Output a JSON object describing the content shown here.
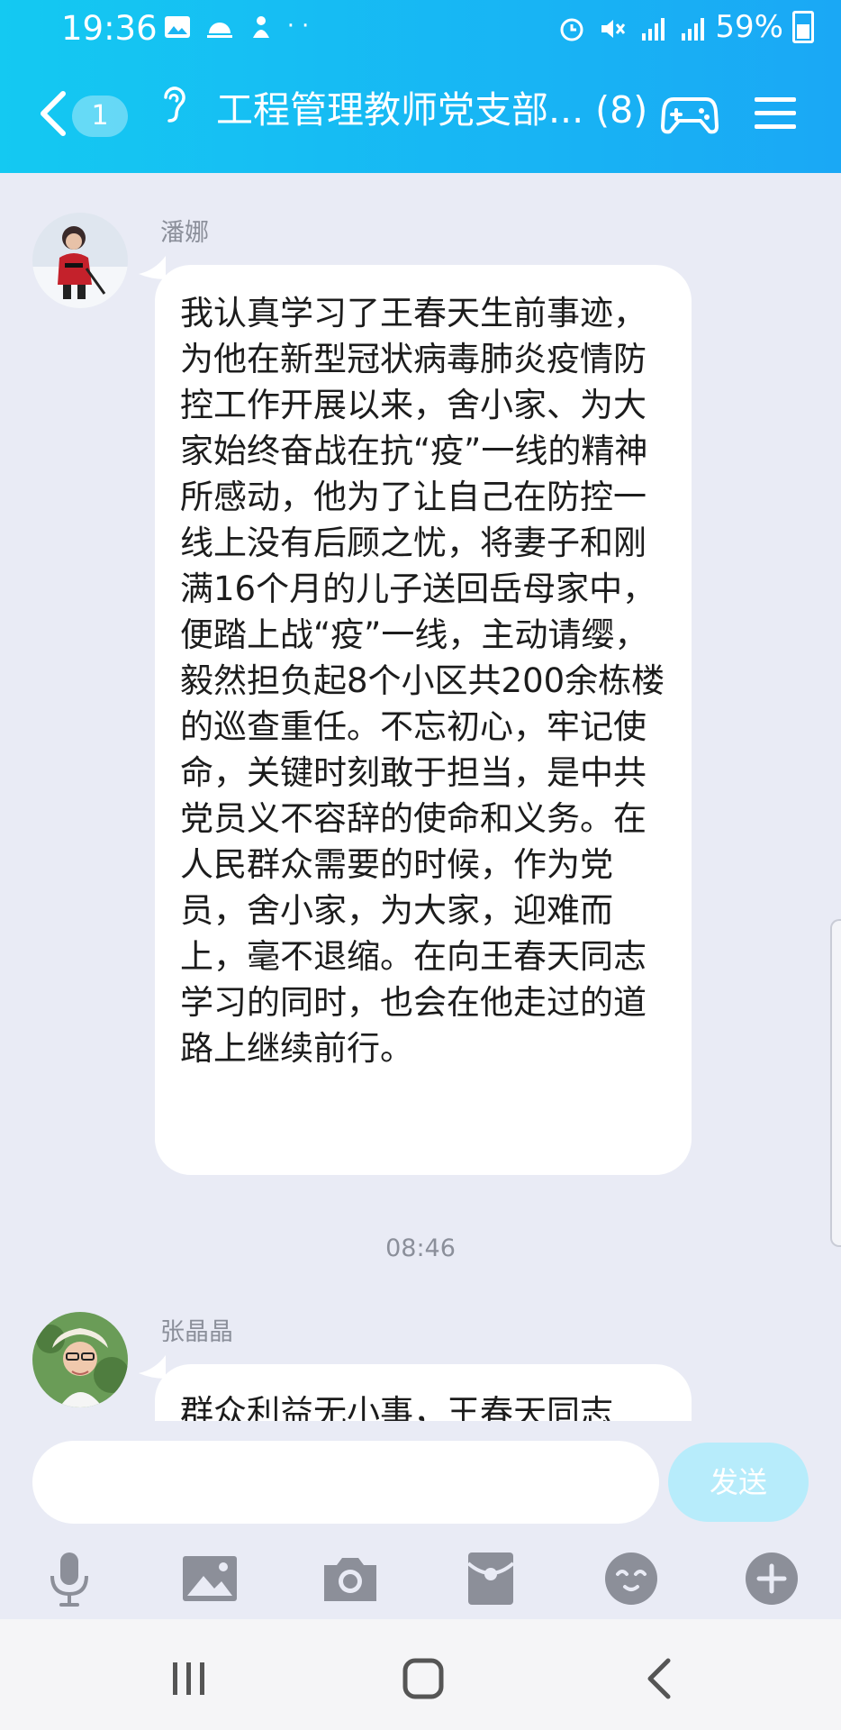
{
  "status_bar": {
    "time": "19:36",
    "battery": "59%",
    "left_icons": [
      "image-icon",
      "weather-icon",
      "app-icon",
      "more-dots-icon"
    ],
    "right_icons": [
      "alarm-icon",
      "mute-icon",
      "signal-icon",
      "4g-signal-icon",
      "battery-icon"
    ]
  },
  "header": {
    "unread_count": "1",
    "title": "工程管理教师党支部... (8)"
  },
  "messages": [
    {
      "sender": "潘娜",
      "text": "我认真学习了王春天生前事迹，为他在新型冠状病毒肺炎疫情防控工作开展以来，舍小家、为大家始终奋战在抗“疫”一线的精神所感动，他为了让自己在防控一线上没有后顾之忧，将妻子和刚满16个月的儿子送回岳母家中，便踏上战“疫”一线，主动请缨，毅然担负起8个小区共200余栋楼的巡查重任。不忘初心，牢记使命，关键时刻敢于担当，是中共党员义不容辞的使命和义务。在人民群众需要的时候，作为党员，舍小家，为大家，迎难而上，毫不退缩。在向王春天同志学习的同时，也会在他走过的道路上继续前行。"
    },
    {
      "time_divider": "08:46"
    },
    {
      "sender": "张晶晶",
      "text": "群众利益无小事，王春天同志"
    }
  ],
  "input": {
    "placeholder": "",
    "send_label": "发送"
  },
  "toolbar": [
    "microphone-icon",
    "image-icon",
    "camera-icon",
    "red-packet-icon",
    "emoji-icon",
    "plus-icon"
  ],
  "colors": {
    "header_start": "#14c9f2",
    "header_end": "#1aa8f5",
    "background": "#e9ebf5",
    "send_button": "#b7ecfb",
    "icon_gray": "#8c8f99"
  }
}
